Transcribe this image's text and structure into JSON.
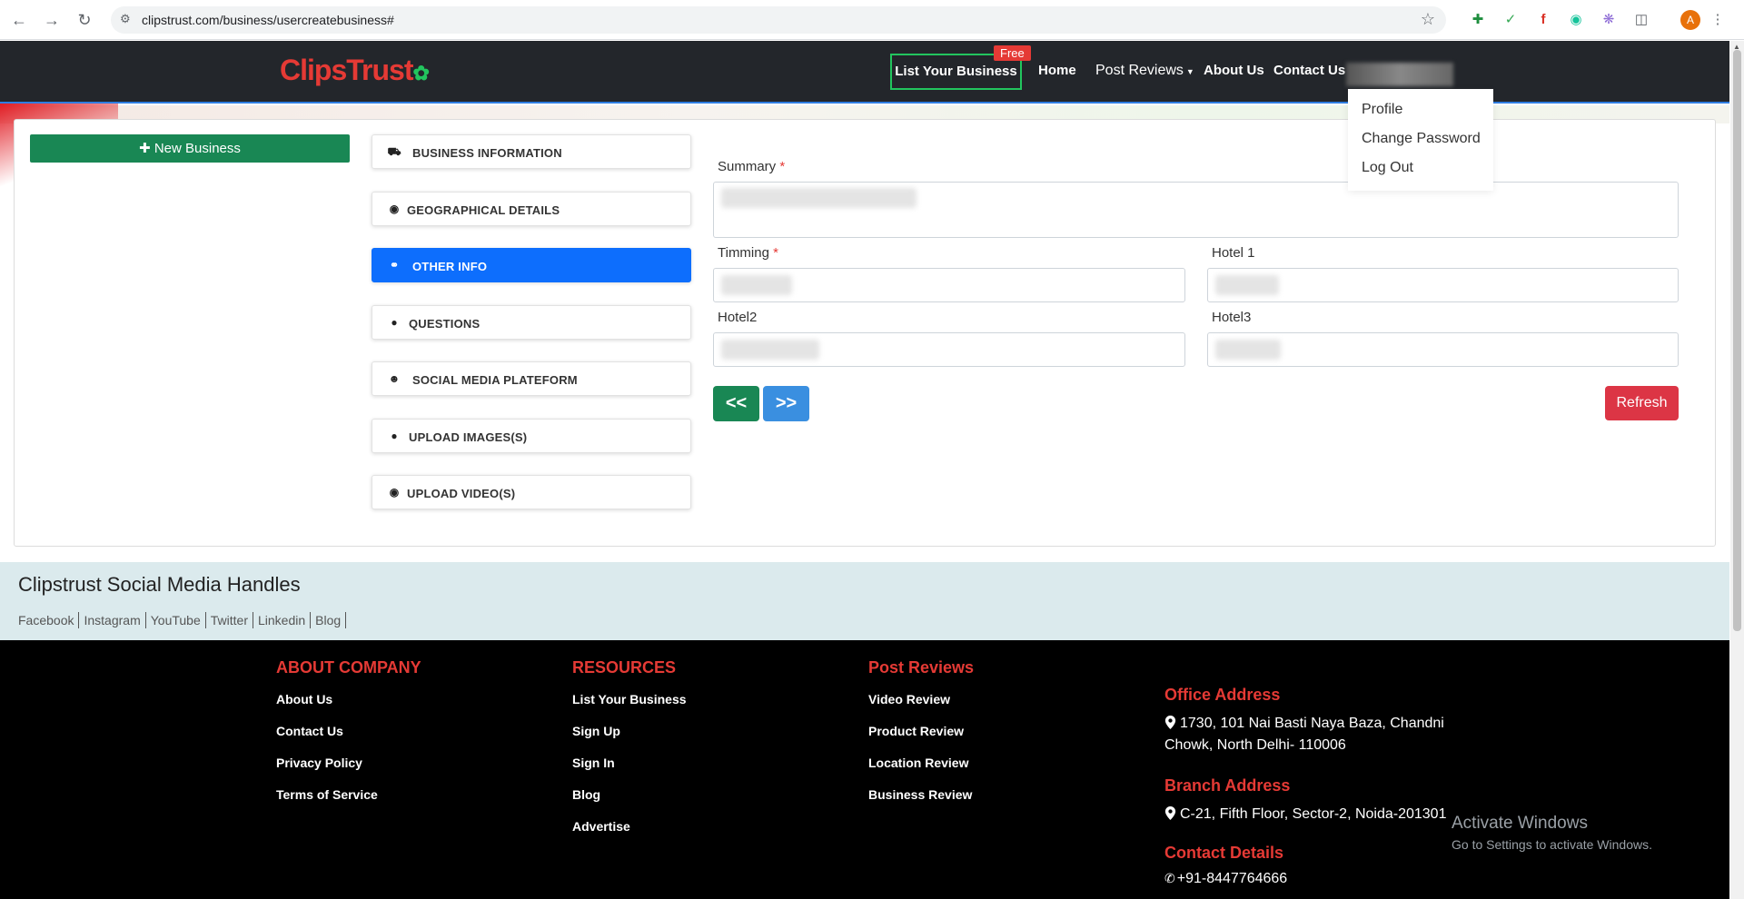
{
  "browser": {
    "url": "clipstrust.com/business/usercreatebusiness#",
    "avatar_letter": "A"
  },
  "header": {
    "logo_text": "ClipsTrust",
    "nav": {
      "list_business": "List Your Business",
      "free_badge": "Free",
      "home": "Home",
      "post_reviews": "Post Reviews",
      "about": "About Us",
      "contact": "Contact Us"
    },
    "user_menu": {
      "profile": "Profile",
      "change_password": "Change Password",
      "logout": "Log Out"
    }
  },
  "sidebar": {
    "new_business": "New Business"
  },
  "steps": [
    {
      "label": "BUSINESS INFORMATION",
      "icon": "car-icon",
      "active": false
    },
    {
      "label": "GEOGRAPHICAL DETAILS",
      "icon": "map-pin-icon",
      "active": false
    },
    {
      "label": "OTHER INFO",
      "icon": "link-icon",
      "active": true
    },
    {
      "label": "QUESTIONS",
      "icon": "user-icon",
      "active": false
    },
    {
      "label": "SOCIAL MEDIA PLATEFORM",
      "icon": "users-icon",
      "active": false
    },
    {
      "label": "UPLOAD IMAGES(S)",
      "icon": "user-icon",
      "active": false
    },
    {
      "label": "UPLOAD VIDEO(S)",
      "icon": "map-pin-icon",
      "active": false
    }
  ],
  "form": {
    "summary_label": "Summary",
    "timing_label": "Timming",
    "hotel1_label": "Hotel 1",
    "hotel2_label": "Hotel2",
    "hotel3_label": "Hotel3",
    "required_mark": "*",
    "prev_label": "<<",
    "next_label": ">>",
    "refresh_label": "Refresh"
  },
  "social": {
    "title": "Clipstrust Social Media Handles",
    "links": [
      "Facebook",
      "Instagram",
      "YouTube",
      "Twitter",
      "Linkedin",
      "Blog"
    ]
  },
  "footer": {
    "about_company": {
      "title": "ABOUT COMPANY",
      "links": [
        "About Us",
        "Contact Us",
        "Privacy Policy",
        "Terms of Service"
      ]
    },
    "resources": {
      "title": "RESOURCES",
      "links": [
        "List Your Business",
        "Sign Up",
        "Sign In",
        "Blog",
        "Advertise"
      ]
    },
    "post_reviews": {
      "title": "Post Reviews",
      "links": [
        "Video Review",
        "Product Review",
        "Location Review",
        "Business Review"
      ]
    },
    "office_title": "Office Address",
    "office_address": "1730, 101 Nai Basti Naya Baza, Chandni Chowk, North Delhi- 110006",
    "branch_title": "Branch Address",
    "branch_address": "C-21, Fifth Floor, Sector-2, Noida-201301",
    "contact_title": "Contact Details",
    "phone": "+91-8447764666"
  },
  "windows_watermark": {
    "line1": "Activate Windows",
    "line2": "Go to Settings to activate Windows."
  },
  "colors": {
    "header_bg": "#23262b",
    "accent_red": "#e53a35",
    "active_blue": "#0d6efd",
    "green": "#198754",
    "social_bg": "#dbeaed"
  }
}
